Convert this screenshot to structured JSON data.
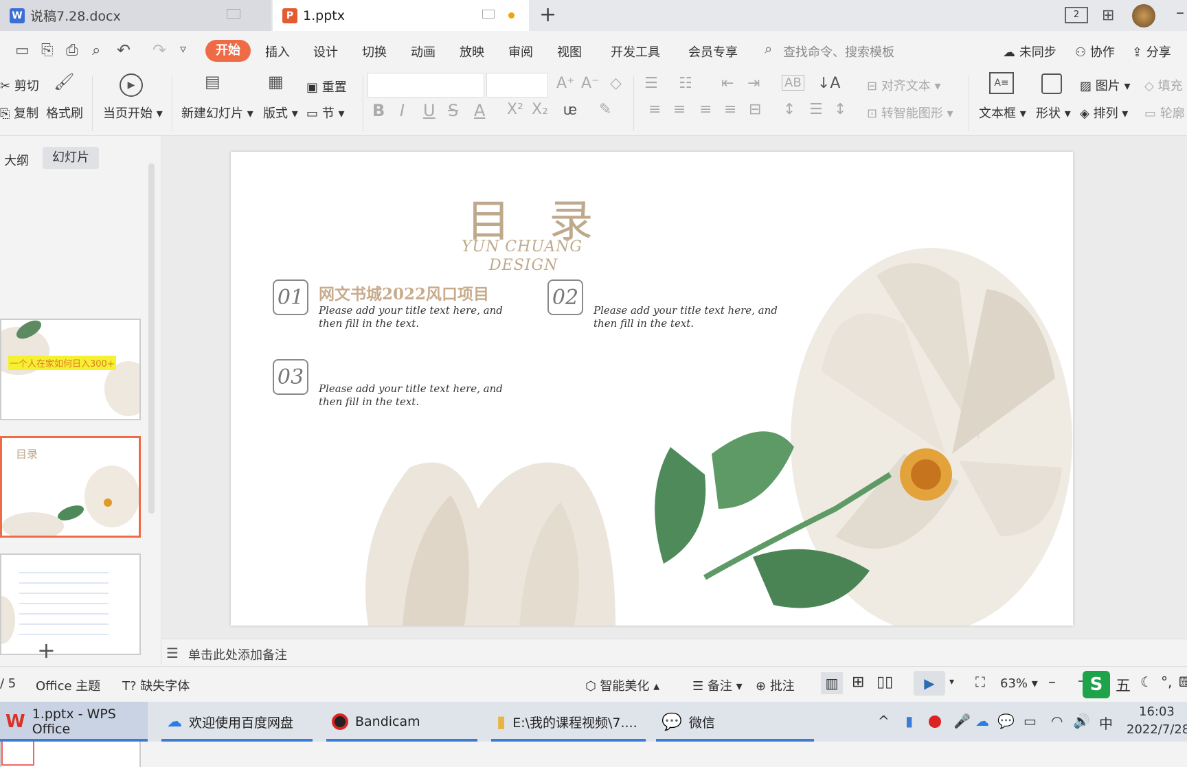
{
  "tabs": {
    "doc1": "说稿7.28.docx",
    "doc2": "1.pptx"
  },
  "menu": {
    "items": [
      "开始",
      "插入",
      "设计",
      "切换",
      "动画",
      "放映",
      "审阅",
      "视图",
      "开发工具",
      "会员专享"
    ],
    "search": "查找命令、搜索模板",
    "sync": "未同步",
    "collab": "协作",
    "share": "分享"
  },
  "ribbon": {
    "cut": "剪切",
    "copy": "复制",
    "format_painter": "格式刷",
    "play_current": "当页开始",
    "new_slide": "新建幻灯片",
    "layout": "版式",
    "reset": "重置",
    "section": "节",
    "align_text": "对齐文本",
    "smart_art": "转智能图形",
    "textbox": "文本框",
    "shape": "形状",
    "picture": "图片",
    "arrange": "排列",
    "fill": "填充",
    "outline": "轮廓"
  },
  "panel": {
    "outline_tab": "大纲",
    "slides_tab": "幻灯片",
    "thumb1_title": "一个人在家如何日入300+",
    "thumb2_title": "目录"
  },
  "slide": {
    "title": "目 录",
    "subtitle_line1": "YUN CHUANG",
    "subtitle_line2": "DESIGN",
    "items": [
      {
        "num": "01",
        "heading": "网文书城2022风口项目",
        "text": "Please add your title text here, and then fill in the text."
      },
      {
        "num": "02",
        "heading": "",
        "text": "Please add your title text here, and then fill in the text."
      },
      {
        "num": "03",
        "heading": "",
        "text": "Please add your title text here, and then fill in the text."
      }
    ]
  },
  "notes": {
    "placeholder": "单击此处添加备注"
  },
  "status": {
    "page": "/ 5",
    "theme": "Office 主题",
    "missing_font": "缺失字体",
    "beautify": "智能美化",
    "notes": "备注",
    "comment": "批注",
    "zoom": "63%"
  },
  "taskbar": {
    "app1": "1.pptx - WPS Office",
    "app2": "欢迎使用百度网盘",
    "app3": "Bandicam",
    "app4": "E:\\我的课程视频\\7....",
    "app5": "微信",
    "ime": "中",
    "time": "16:03",
    "date": "2022/7/28"
  },
  "colors": {
    "accent": "#ef6b45",
    "title_tan": "#bfa98c",
    "leaf": "#4e8a5a"
  }
}
